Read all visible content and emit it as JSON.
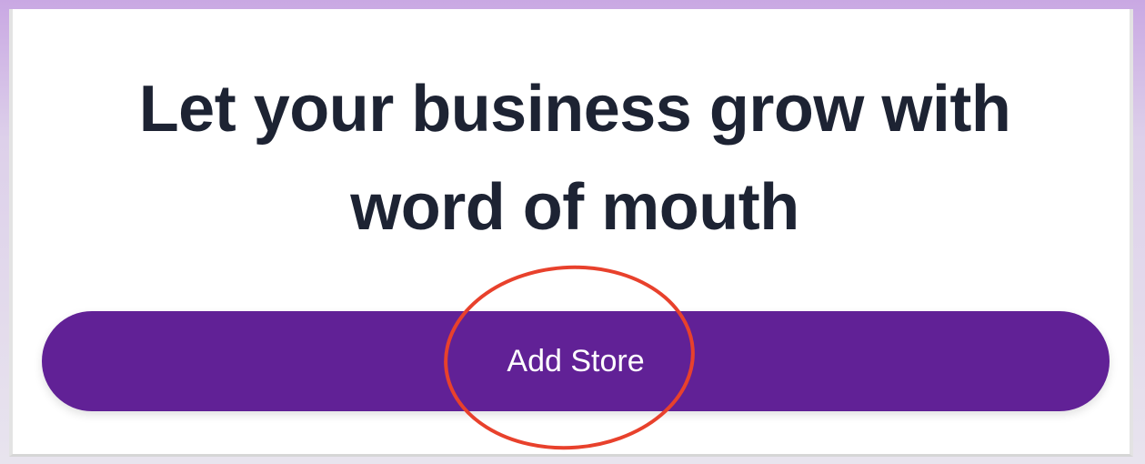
{
  "hero": {
    "headline_line1": "Let your business grow with",
    "headline_line2": "word of mouth"
  },
  "cta": {
    "label": "Add Store"
  },
  "colors": {
    "button_bg": "#612196",
    "headline": "#1d2333",
    "annotation_circle": "#e8412c"
  }
}
